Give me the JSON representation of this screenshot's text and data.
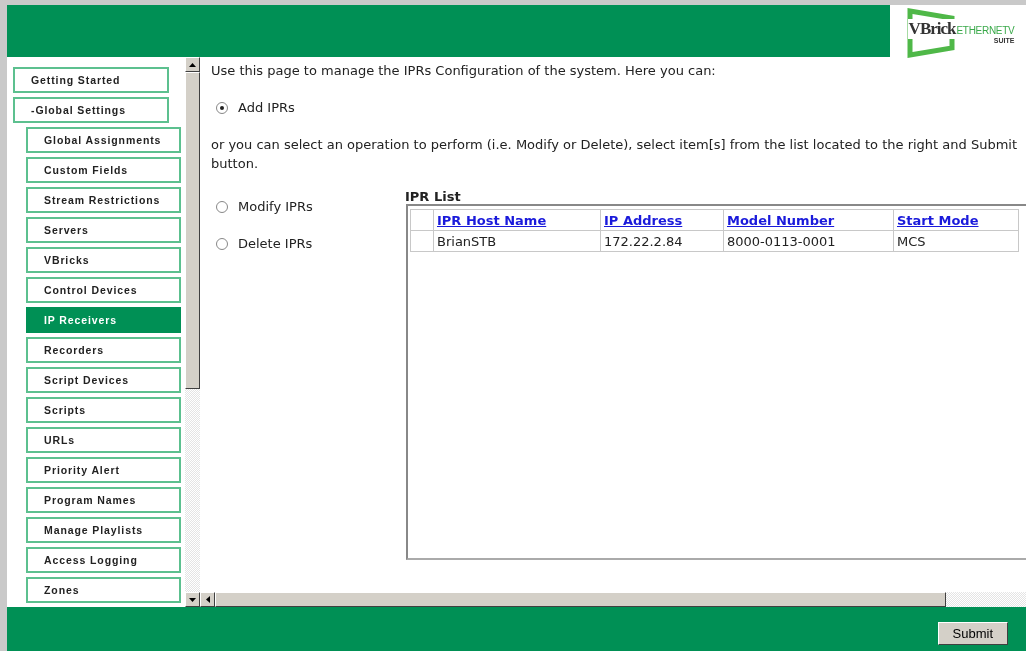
{
  "header": {
    "logo": {
      "brand": "VBrick",
      "product": "ETHERNETV",
      "edition": "SUITE"
    }
  },
  "nav": {
    "items": [
      {
        "label": "Getting Started",
        "selected": false
      },
      {
        "label": "-Global Settings",
        "selected": false,
        "children": [
          {
            "label": "Global Assignments",
            "selected": false
          },
          {
            "label": "Custom Fields",
            "selected": false
          },
          {
            "label": "Stream Restrictions",
            "selected": false
          },
          {
            "label": "Servers",
            "selected": false
          },
          {
            "label": "VBricks",
            "selected": false
          },
          {
            "label": "Control Devices",
            "selected": false
          },
          {
            "label": "IP Receivers",
            "selected": true
          },
          {
            "label": "Recorders",
            "selected": false
          },
          {
            "label": "Script Devices",
            "selected": false
          },
          {
            "label": "Scripts",
            "selected": false
          },
          {
            "label": "URLs",
            "selected": false
          },
          {
            "label": "Priority Alert",
            "selected": false
          },
          {
            "label": "Program Names",
            "selected": false
          },
          {
            "label": "Manage Playlists",
            "selected": false
          },
          {
            "label": "Access Logging",
            "selected": false
          },
          {
            "label": "Zones",
            "selected": false
          }
        ]
      }
    ]
  },
  "content": {
    "intro": "Use this page to manage the IPRs Configuration of the system. Here you can:",
    "add_option": {
      "label": "Add IPRs",
      "selected": true
    },
    "instructions": "or you can select an operation to perform (i.e. Modify or Delete), select item[s] from the list located to the right and Submit button.",
    "operations": [
      {
        "label": "Modify IPRs",
        "selected": false
      },
      {
        "label": "Delete IPRs",
        "selected": false
      }
    ],
    "ipr_list": {
      "title": "IPR List",
      "columns": [
        "IPR Host Name",
        "IP Address",
        "Model Number",
        "Start Mode"
      ],
      "rows": [
        [
          "BrianSTB",
          "172.22.2.84",
          "8000-0113-0001",
          "MCS"
        ]
      ]
    }
  },
  "footer": {
    "submit": "Submit"
  }
}
